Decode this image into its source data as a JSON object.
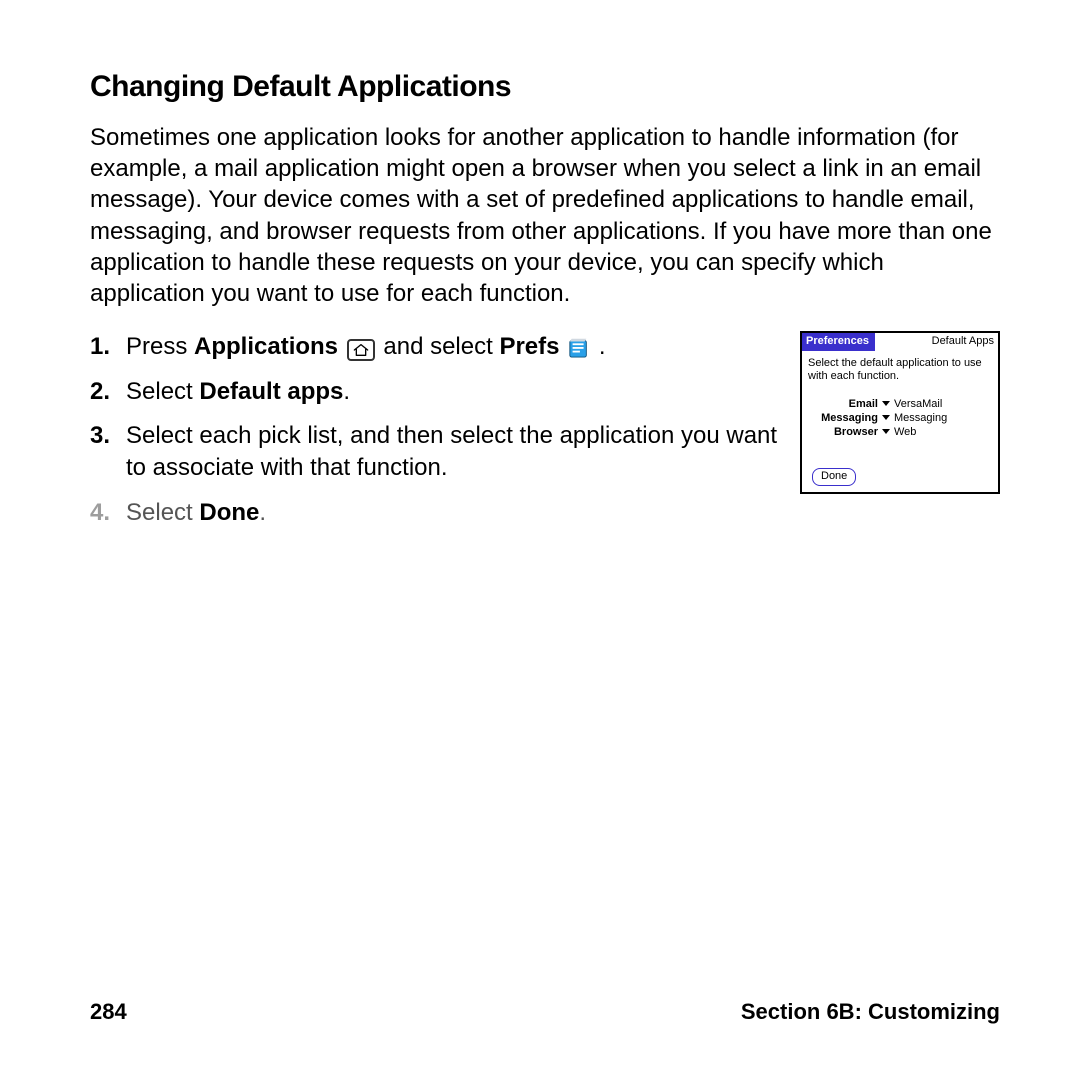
{
  "heading": "Changing Default Applications",
  "intro": "Sometimes one application looks for another application to handle information (for example, a mail application might open a browser when you select a link in an email message). Your device comes with a set of predefined applications to handle email, messaging, and browser requests from other applications. If you have more than one application to handle these requests on your device, you can specify which application you want to use for each function.",
  "steps": {
    "s1a": "Press ",
    "s1b": "Applications",
    "s1c": " and select ",
    "s1d": "Prefs",
    "s1e": " .",
    "s2a": "Select ",
    "s2b": "Default apps",
    "s2c": ".",
    "s3": "Select each pick list, and then select the application you want to associate with that function.",
    "s4a": "Select ",
    "s4b": "Done",
    "s4c": "."
  },
  "palm": {
    "title_left": "Preferences",
    "title_right": "Default Apps",
    "desc": "Select the default application to use with each function.",
    "rows": [
      {
        "label": "Email",
        "value": "VersaMail"
      },
      {
        "label": "Messaging",
        "value": "Messaging"
      },
      {
        "label": "Browser",
        "value": "Web"
      }
    ],
    "done": "Done"
  },
  "footer": {
    "page": "284",
    "section": "Section 6B: Customizing"
  }
}
